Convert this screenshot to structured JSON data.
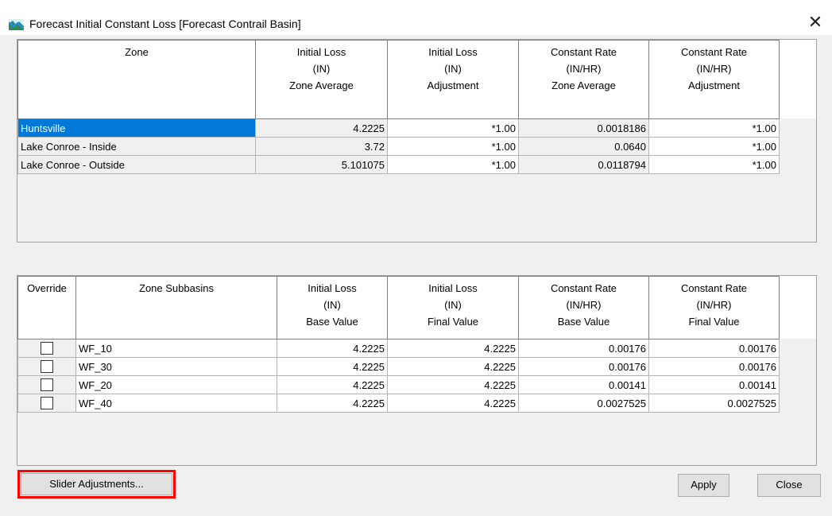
{
  "window": {
    "title": "Forecast Initial Constant Loss [Forecast Contrail Basin]",
    "close_glyph": "✕"
  },
  "zone_table": {
    "headers": [
      [
        "Zone"
      ],
      [
        "Initial Loss",
        "(IN)",
        "Zone Average"
      ],
      [
        "Initial Loss",
        "(IN)",
        "Adjustment"
      ],
      [
        "Constant Rate",
        "(IN/HR)",
        "Zone Average"
      ],
      [
        "Constant Rate",
        "(IN/HR)",
        "Adjustment"
      ]
    ],
    "rows": [
      {
        "zone": "Huntsville",
        "il_avg": "4.2225",
        "il_adj": "*1.00",
        "cr_avg": "0.0018186",
        "cr_adj": "*1.00",
        "selected": true
      },
      {
        "zone": "Lake Conroe - Inside",
        "il_avg": "3.72",
        "il_adj": "*1.00",
        "cr_avg": "0.0640",
        "cr_adj": "*1.00"
      },
      {
        "zone": "Lake Conroe - Outside",
        "il_avg": "5.101075",
        "il_adj": "*1.00",
        "cr_avg": "0.0118794",
        "cr_adj": "*1.00"
      }
    ]
  },
  "subbasin_table": {
    "headers": [
      [
        "Override"
      ],
      [
        "Zone Subbasins"
      ],
      [
        "Initial Loss",
        "(IN)",
        "Base Value"
      ],
      [
        "Initial Loss",
        "(IN)",
        "Final Value"
      ],
      [
        "Constant Rate",
        "(IN/HR)",
        "Base Value"
      ],
      [
        "Constant Rate",
        "(IN/HR)",
        "Final Value"
      ]
    ],
    "rows": [
      {
        "override": false,
        "name": "WF_10",
        "il_base": "4.2225",
        "il_final": "4.2225",
        "cr_base": "0.00176",
        "cr_final": "0.00176"
      },
      {
        "override": false,
        "name": "WF_30",
        "il_base": "4.2225",
        "il_final": "4.2225",
        "cr_base": "0.00176",
        "cr_final": "0.00176"
      },
      {
        "override": false,
        "name": "WF_20",
        "il_base": "4.2225",
        "il_final": "4.2225",
        "cr_base": "0.00141",
        "cr_final": "0.00141"
      },
      {
        "override": false,
        "name": "WF_40",
        "il_base": "4.2225",
        "il_final": "4.2225",
        "cr_base": "0.0027525",
        "cr_final": "0.0027525"
      }
    ]
  },
  "buttons": {
    "slider": "Slider Adjustments...",
    "apply": "Apply",
    "close": "Close"
  },
  "colors": {
    "selection": "#0078d7",
    "highlight_box": "#ff0000",
    "app_icon_green": "#2e8b57",
    "app_icon_blue": "#1e90ff"
  }
}
